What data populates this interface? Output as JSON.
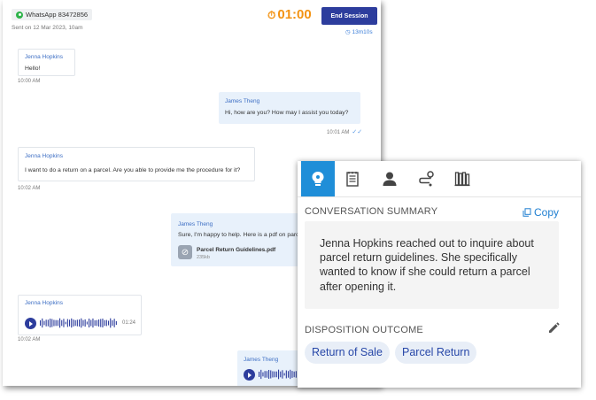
{
  "header": {
    "channel_label": "WhatsApp 83472856",
    "sent_on": "Sent on 12 Mar 2023, 10am",
    "timer": "01:00",
    "end_session_label": "End Session",
    "elapsed": "13m10s"
  },
  "messages": [
    {
      "sender": "Jenna Hopkins",
      "text": "Hello!",
      "time": "10:00 AM"
    },
    {
      "sender": "James Theng",
      "text": "Hi, how are you? How may I assist you today?",
      "time": "10:01 AM"
    },
    {
      "sender": "Jenna Hopkins",
      "text": "I want to do a return on a parcel. Are you able to provide me the procedure for it?",
      "time": "10:02 AM"
    },
    {
      "sender": "James Theng",
      "text": "Sure, I'm happy to help. Here is a pdf on parcel",
      "attachment_name": "Parcel Return Guidelines.pdf",
      "attachment_size": "235kb"
    },
    {
      "sender": "Jenna Hopkins",
      "duration": "01:24",
      "time": "10:02 AM"
    },
    {
      "sender": "James Theng"
    }
  ],
  "panel": {
    "tabs": [
      {
        "icon": "lightbulb-icon",
        "active": true
      },
      {
        "icon": "notes-icon",
        "active": false
      },
      {
        "icon": "person-icon",
        "active": false
      },
      {
        "icon": "route-icon",
        "active": false
      },
      {
        "icon": "book-icon",
        "active": false
      }
    ],
    "summary_title": "CONVERSATION SUMMARY",
    "copy_label": "Copy",
    "summary_text": "Jenna Hopkins reached out to inquire about parcel return guidelines. She specifically wanted to know if she could return a parcel after opening it.",
    "disposition_title": "DISPOSITION OUTCOME",
    "chips": [
      "Return of Sale",
      "Parcel Return"
    ]
  },
  "colors": {
    "accent": "#1f8ed8",
    "button": "#2d3d9d",
    "timer": "#f39313",
    "chip_bg": "#e8eef7",
    "chip_text": "#2747a8"
  }
}
